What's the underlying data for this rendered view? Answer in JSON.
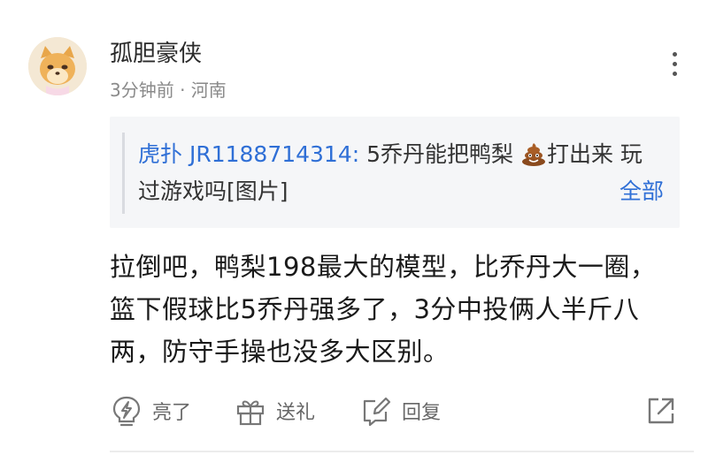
{
  "post": {
    "username": "孤胆豪侠",
    "meta": "3分钟前 · 河南",
    "quote": {
      "author": "虎扑 JR1188714314:",
      "text_before_emoji": " 5乔丹能把鸭梨",
      "emoji": "poo-emoji",
      "text_after_emoji": "打出来 玩过游戏吗[图片]",
      "more_label": "全部"
    },
    "body": "拉倒吧，鸭梨198最大的模型，比乔丹大一圈，篮下假球比5乔丹强多了，3分中投俩人半斤八两，防守手操也没多大区别。"
  },
  "actions": {
    "light_label": "亮了",
    "gift_label": "送礼",
    "reply_label": "回复"
  },
  "icons": {
    "light": "lightning-bulb-icon",
    "gift": "gift-icon",
    "reply": "edit-reply-icon",
    "share": "share-icon",
    "more": "more-vertical-icon"
  },
  "colors": {
    "link_blue": "#2f6fd6",
    "meta_gray": "#8a8a8a",
    "quote_bg": "#f5f6f8"
  }
}
